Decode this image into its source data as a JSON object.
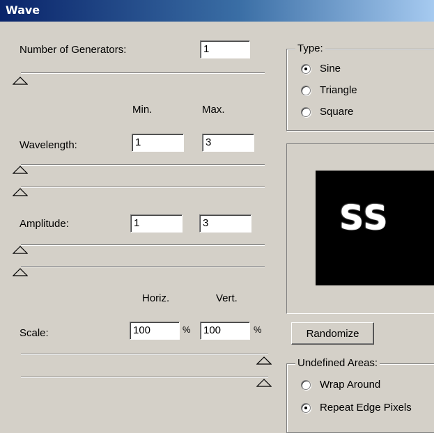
{
  "window": {
    "title": "Wave"
  },
  "generators": {
    "label": "Number of Generators:",
    "mnemonic": "G",
    "value": "1"
  },
  "columns": {
    "min": "Min.",
    "max": "Max."
  },
  "wavelength": {
    "label": "Wavelength:",
    "mnemonic": "W",
    "min": "1",
    "max": "3"
  },
  "amplitude": {
    "label": "Amplitude:",
    "mnemonic": "A",
    "min": "1",
    "max": "3"
  },
  "scale_columns": {
    "horiz": "Horiz.",
    "vert": "Vert."
  },
  "scale": {
    "label": "Scale:",
    "mnemonic": "S",
    "horiz": "100",
    "vert": "100",
    "unit": "%"
  },
  "type_group": {
    "legend": "Type:",
    "options": [
      {
        "label": "Sine",
        "mnemonic": "i",
        "checked": true
      },
      {
        "label": "Triangle",
        "mnemonic": "T",
        "checked": false
      },
      {
        "label": "Square",
        "mnemonic": "q",
        "checked": false
      }
    ]
  },
  "preview": {
    "text": "SS",
    "background": "#000000",
    "text_color": "#ffffff"
  },
  "randomize": {
    "label": "Randomize",
    "mnemonic": "z"
  },
  "undefined_group": {
    "legend": "Undefined Areas:",
    "options": [
      {
        "label": "Wrap Around",
        "mnemonic": "r",
        "checked": false
      },
      {
        "label": "Repeat Edge Pixels",
        "mnemonic": "E",
        "checked": true
      }
    ]
  },
  "colors": {
    "title_start": "#0a246a",
    "title_end": "#a6caf0",
    "face": "#d4d0c8"
  }
}
